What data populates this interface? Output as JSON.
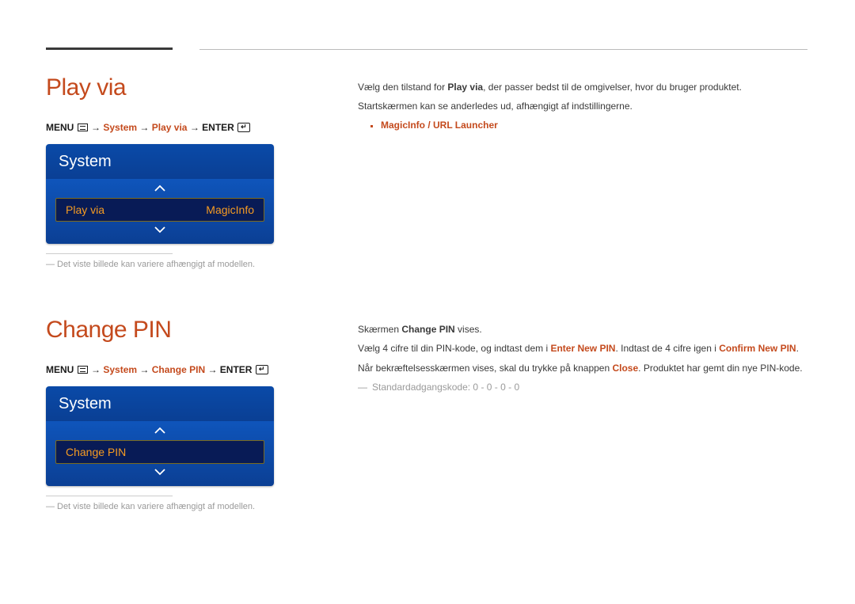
{
  "section1": {
    "heading": "Play via",
    "breadcrumb": {
      "menu": "MENU",
      "system": "System",
      "item": "Play via",
      "enter": "ENTER"
    },
    "panel": {
      "title": "System",
      "row_label": "Play via",
      "row_value": "MagicInfo"
    },
    "note": "Det viste billede kan variere afhængigt af modellen.",
    "body": {
      "line1_pre": "Vælg den tilstand for ",
      "line1_bold": "Play via",
      "line1_post": ", der passer bedst til de omgivelser, hvor du bruger produktet.",
      "line2": "Startskærmen kan se anderledes ud, afhængigt af indstillingerne.",
      "bullet": "MagicInfo / URL Launcher"
    }
  },
  "section2": {
    "heading": "Change PIN",
    "breadcrumb": {
      "menu": "MENU",
      "system": "System",
      "item": "Change PIN",
      "enter": "ENTER"
    },
    "panel": {
      "title": "System",
      "row_label": "Change PIN"
    },
    "note": "Det viste billede kan variere afhængigt af modellen.",
    "body": {
      "line1_pre": "Skærmen ",
      "line1_bold": "Change PIN",
      "line1_post": " vises.",
      "line2_pre": "Vælg 4 cifre til din PIN-kode, og indtast dem i ",
      "line2_bold1": "Enter New PIN",
      "line2_mid": ". Indtast de 4 cifre igen i ",
      "line2_bold2": "Confirm New PIN",
      "line2_end": ".",
      "line3_pre": "Når bekræftelsesskærmen vises, skal du trykke på knappen ",
      "line3_bold": "Close",
      "line3_post": ". Produktet har gemt din nye PIN-kode.",
      "graynote": "Standardadgangskode: 0 - 0 - 0 - 0"
    }
  }
}
